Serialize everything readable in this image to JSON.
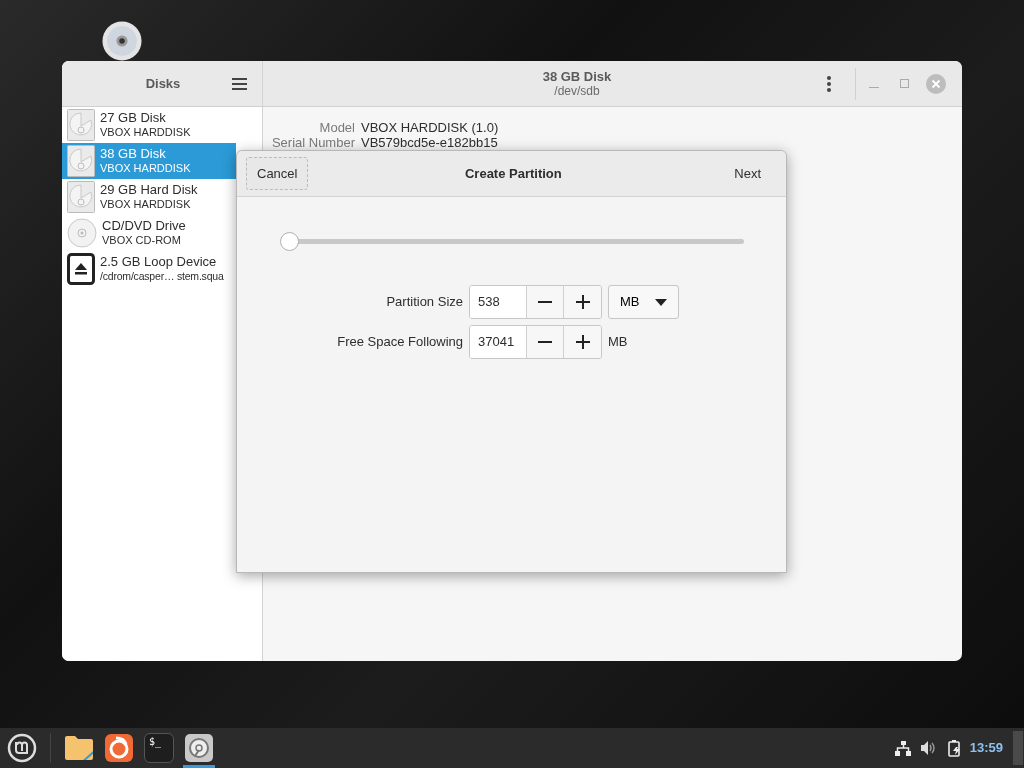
{
  "sidebar": {
    "title": "Disks",
    "items": [
      {
        "name": "27 GB Disk",
        "detail": "VBOX HARDDISK",
        "kind": "hdd",
        "selected": false
      },
      {
        "name": "38 GB Disk",
        "detail": "VBOX HARDDISK",
        "kind": "hdd",
        "selected": true
      },
      {
        "name": "29 GB Hard Disk",
        "detail": "VBOX HARDDISK",
        "kind": "hdd",
        "selected": false
      },
      {
        "name": "CD/DVD Drive",
        "detail": "VBOX CD-ROM",
        "kind": "optical",
        "selected": false
      },
      {
        "name": "2.5 GB Loop Device",
        "detail": "/cdrom/casper… stem.squa",
        "kind": "loop",
        "selected": false
      }
    ]
  },
  "header": {
    "title": "38 GB Disk",
    "subtitle": "/dev/sdb"
  },
  "details": [
    {
      "label": "Model",
      "value": "VBOX HARDDISK (1.0)"
    },
    {
      "label": "Serial Number",
      "value": "VB579bcd5e-e182bb15"
    }
  ],
  "dialog": {
    "title": "Create Partition",
    "cancel": "Cancel",
    "next": "Next",
    "slider": {
      "level": 0.015
    },
    "fields": [
      {
        "label": "Partition Size",
        "value": "538",
        "unit": "MB",
        "kind": "dropdown"
      },
      {
        "label": "Free Space Following",
        "value": "37041",
        "unit": "MB",
        "kind": "text"
      }
    ]
  },
  "taskbar": {
    "apps": [
      {
        "kind": "files",
        "active": false
      },
      {
        "kind": "browser",
        "active": false
      },
      {
        "kind": "terminal",
        "label": "$_",
        "active": false
      },
      {
        "kind": "disks",
        "active": true
      }
    ],
    "clock": "13:59"
  }
}
